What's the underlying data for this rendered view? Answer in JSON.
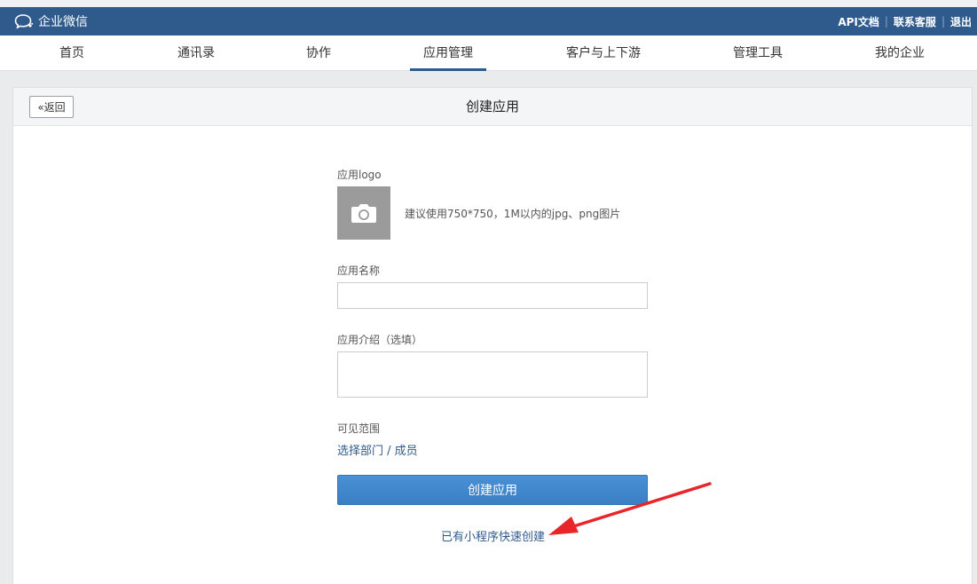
{
  "brand": {
    "name": "企业微信",
    "icon": "chat-bubble-icon"
  },
  "toplinks": [
    {
      "label": "API文档"
    },
    {
      "label": "联系客服"
    },
    {
      "label": "退出"
    }
  ],
  "toplink_sep": "|",
  "nav": {
    "items": [
      {
        "label": "首页"
      },
      {
        "label": "通讯录"
      },
      {
        "label": "协作"
      },
      {
        "label": "应用管理"
      },
      {
        "label": "客户与上下游"
      },
      {
        "label": "管理工具"
      },
      {
        "label": "我的企业"
      }
    ],
    "active": "应用管理"
  },
  "page": {
    "back_label": "«返回",
    "title": "创建应用"
  },
  "form": {
    "logo_label": "应用logo",
    "logo_icon": "camera-icon",
    "logo_hint": "建议使用750*750，1M以内的jpg、png图片",
    "name_label": "应用名称",
    "name_value": "",
    "intro_label": "应用介绍（选填）",
    "intro_value": "",
    "scope_label": "可见范围",
    "scope_link": "选择部门 / 成员",
    "submit_label": "创建应用",
    "quick_link": "已有小程序快速创建"
  },
  "annotation": {
    "arrow_color": "#e8262a"
  },
  "colors": {
    "brand_bar": "#2f5a8c",
    "primary_button": "#3a7fc4",
    "link": "#2f5a8c"
  }
}
